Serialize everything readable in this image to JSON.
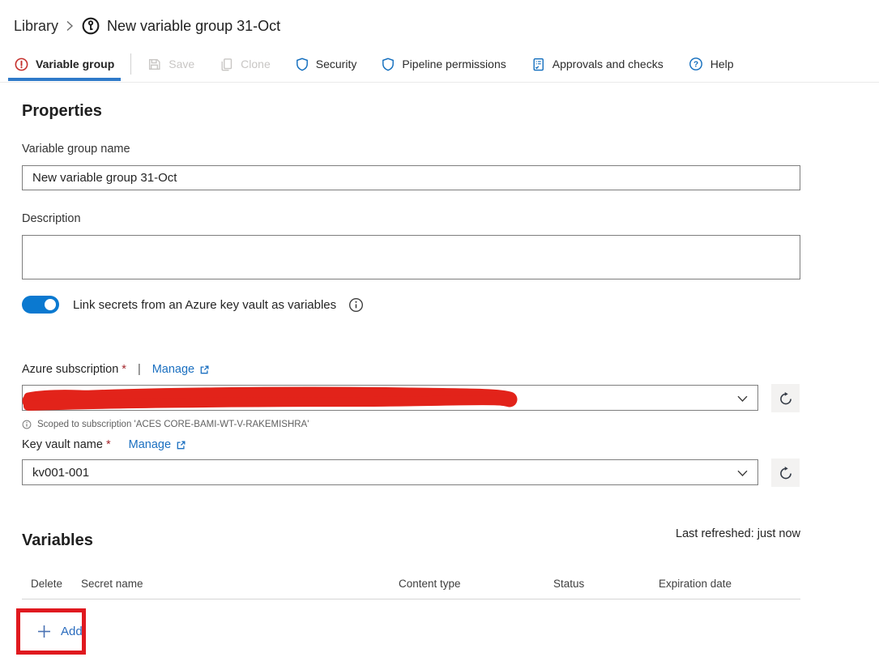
{
  "breadcrumb": {
    "library": "Library",
    "title": "New variable group 31-Oct"
  },
  "toolbar": {
    "tab_label": "Variable group",
    "save_label": "Save",
    "clone_label": "Clone",
    "security_label": "Security",
    "pipeline_permissions_label": "Pipeline permissions",
    "approvals_label": "Approvals and checks",
    "help_label": "Help"
  },
  "properties": {
    "heading": "Properties",
    "name_label": "Variable group name",
    "name_value": "New variable group 31-Oct",
    "description_label": "Description",
    "description_value": "",
    "toggle_label": "Link secrets from an Azure key vault as variables",
    "toggle_state": "on"
  },
  "subscription": {
    "label": "Azure subscription",
    "required": "*",
    "divider": "|",
    "manage": "Manage",
    "value_redacted": true,
    "scoped_note": "Scoped to subscription 'ACES CORE-BAMI-WT-V-RAKEMISHRA'"
  },
  "keyvault": {
    "label": "Key vault name",
    "required": "*",
    "manage": "Manage",
    "value": "kv001-001"
  },
  "variables": {
    "heading": "Variables",
    "last_refreshed": "Last refreshed: just now",
    "columns": [
      "Delete",
      "Secret name",
      "Content type",
      "Status",
      "Expiration date"
    ],
    "add": "Add"
  },
  "icons": {
    "breadcrumb_chevron": "›",
    "variable_group": "key-in-circle",
    "tab_error": "!",
    "save": "floppy-disk",
    "clone": "copy",
    "security": "shield",
    "pipeline_permissions": "shield",
    "approvals": "checklist",
    "help": "?",
    "info": "i",
    "external_link": "↗",
    "dropdown_chevron": "⌄",
    "refresh": "⟳",
    "add_plus": "+",
    "redaction": "marker-stroke"
  },
  "colors": {
    "accent": "#0078d4",
    "link_blue": "#1a6fc0",
    "icon_blue": "#0f6cbd",
    "error_red": "#c5302c",
    "annotation_red": "#e0191f",
    "scribble_red": "#e2231a",
    "disabled_gray": "#c8c6c4",
    "border_gray": "#7e7e7e"
  }
}
